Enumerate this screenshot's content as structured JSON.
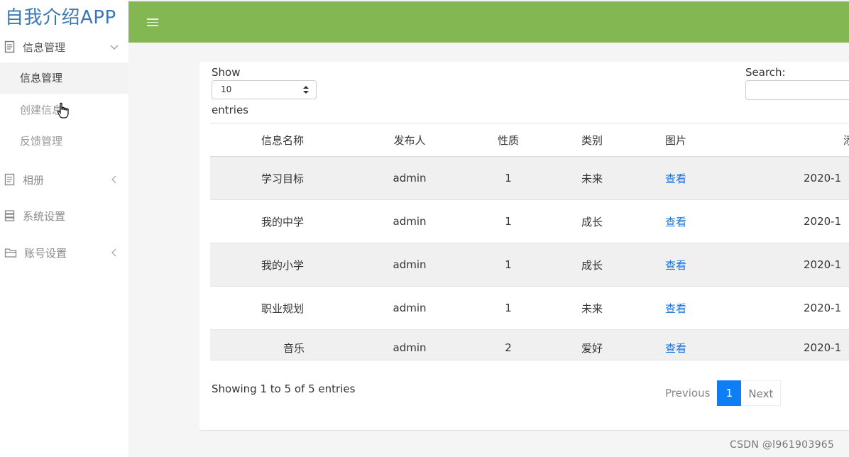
{
  "sidebar": {
    "app_title": "自我介绍APP",
    "groups": [
      {
        "label": "信息管理",
        "icon": "document-icon",
        "expanded": true
      },
      {
        "label": "相册",
        "icon": "document-icon",
        "expanded": false
      },
      {
        "label": "系统设置",
        "icon": "database-icon"
      },
      {
        "label": "账号设置",
        "icon": "folder-icon",
        "expanded": false
      }
    ],
    "submenu": [
      {
        "label": "信息管理",
        "selected": true
      },
      {
        "label": "创建信息"
      },
      {
        "label": "反馈管理"
      }
    ]
  },
  "header": {
    "bar_color": "#82b752",
    "menu_icon": "hamburger-icon"
  },
  "table_controls": {
    "show_label": "Show",
    "length_value": "10",
    "entries_label": "entries",
    "search_label": "Search:"
  },
  "table": {
    "columns": [
      "信息名称",
      "发布人",
      "性质",
      "类别",
      "图片",
      "添"
    ],
    "rows": [
      {
        "name": "学习目标",
        "publisher": "admin",
        "type": "1",
        "category": "未来",
        "image": "查看",
        "time": "2020-1"
      },
      {
        "name": "我的中学",
        "publisher": "admin",
        "type": "1",
        "category": "成长",
        "image": "查看",
        "time": "2020-1"
      },
      {
        "name": "我的小学",
        "publisher": "admin",
        "type": "1",
        "category": "成长",
        "image": "查看",
        "time": "2020-1"
      },
      {
        "name": "职业规划",
        "publisher": "admin",
        "type": "1",
        "category": "未来",
        "image": "查看",
        "time": "2020-1"
      },
      {
        "name": "音乐",
        "publisher": "admin",
        "type": "2",
        "category": "爱好",
        "image": "查看",
        "time": "2020-1"
      }
    ]
  },
  "footer": {
    "info": "Showing 1 to 5 of 5 entries",
    "prev": "Previous",
    "page": "1",
    "next": "Next"
  },
  "watermark": "CSDN @l961903965"
}
